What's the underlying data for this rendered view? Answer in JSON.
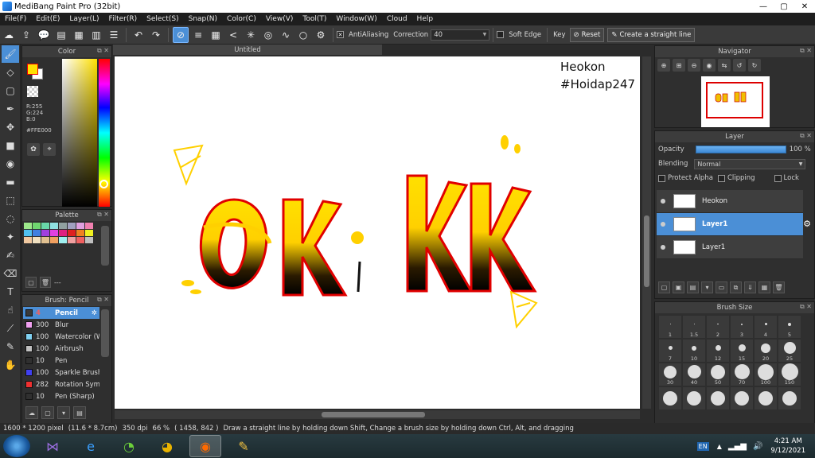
{
  "window": {
    "title": "MediBang Paint Pro (32bit)",
    "controls": [
      "—",
      "▢",
      "✕"
    ]
  },
  "menu": [
    "File(F)",
    "Edit(E)",
    "Layer(L)",
    "Filter(R)",
    "Select(S)",
    "Snap(N)",
    "Color(C)",
    "View(V)",
    "Tool(T)",
    "Window(W)",
    "Cloud",
    "Help"
  ],
  "toolbar": {
    "antialiasing_label": "AntiAliasing",
    "antialiasing_checked": true,
    "correction_label": "Correction",
    "correction_value": "40",
    "soft_edge_label": "Soft Edge",
    "soft_edge_checked": false,
    "key_label": "Key",
    "reset_label": "Reset",
    "straight_line_label": "Create a straight line"
  },
  "color_panel": {
    "title": "Color",
    "r": "R:255",
    "g": "G:224",
    "b": "B:0",
    "hex": "#FFE000",
    "foreground": "#FFE000"
  },
  "palette_panel": {
    "title": "Palette",
    "count_label": "---",
    "colors": [
      "#9ce88a",
      "#6fd66f",
      "#68d8a8",
      "#8fe0e0",
      "#90a0a0",
      "#a0a0c0",
      "#e0a0e0",
      "#f080b0",
      "#50c0f0",
      "#4080e0",
      "#a040e0",
      "#e040e0",
      "#e02080",
      "#e02020",
      "#f08020",
      "#f0f020",
      "#f0c8a0",
      "#f0e0c0",
      "#e0c090",
      "#f0a060",
      "#a0f0f0",
      "#f0a0a0",
      "#f06060",
      "#c0c0c0"
    ]
  },
  "brush_panel": {
    "title": "Brush: Pencil",
    "brushes": [
      {
        "size": "4",
        "name": "Pencil",
        "color": "#3a3a3a",
        "selected": true
      },
      {
        "size": "300",
        "name": "Blur",
        "color": "#f0a0f0",
        "selected": false
      },
      {
        "size": "100",
        "name": "Watercolor (W",
        "color": "#80d0f0",
        "selected": false
      },
      {
        "size": "100",
        "name": "Airbrush",
        "color": "#c0c0c0",
        "selected": false
      },
      {
        "size": "10",
        "name": "Pen",
        "color": "#303030",
        "selected": false
      },
      {
        "size": "100",
        "name": "Sparkle Brush",
        "color": "#4040f0",
        "selected": false
      },
      {
        "size": "282",
        "name": "Rotation Sym",
        "color": "#f03030",
        "selected": false
      },
      {
        "size": "10",
        "name": "Pen (Sharp)",
        "color": "#303030",
        "selected": false
      }
    ]
  },
  "canvas": {
    "tab_title": "Untitled",
    "watermark_line1": "Heokon",
    "watermark_line2": "#Hoidap247"
  },
  "navigator": {
    "title": "Navigator"
  },
  "layer_panel": {
    "title": "Layer",
    "opacity_label": "Opacity",
    "opacity_value": "100 %",
    "opacity_fraction": 1.0,
    "blending_label": "Blending",
    "blending_value": "Normal",
    "protect_alpha_label": "Protect Alpha",
    "clipping_label": "Clipping",
    "lock_label": "Lock",
    "layers": [
      {
        "name": "Heokon",
        "selected": false
      },
      {
        "name": "Layer1",
        "selected": true
      },
      {
        "name": "Layer1",
        "selected": false
      }
    ]
  },
  "brush_size_panel": {
    "title": "Brush Size",
    "sizes": [
      "1",
      "1.5",
      "2",
      "3",
      "4",
      "5",
      "7",
      "10",
      "12",
      "15",
      "20",
      "25",
      "30",
      "40",
      "50",
      "70",
      "100",
      "150",
      "",
      "",
      "",
      "",
      "",
      ""
    ]
  },
  "status": {
    "dimensions": "1600 * 1200 pixel",
    "physical": "(11.6 * 8.7cm)",
    "dpi": "350 dpi",
    "zoom": "66 %",
    "cursor": "( 1458, 842 )",
    "hint": "Draw a straight line by holding down Shift, Change a brush size by holding down Ctrl, Alt, and dragging"
  },
  "taskbar": {
    "lang": "EN",
    "time": "4:21 AM",
    "date": "9/12/2021"
  }
}
